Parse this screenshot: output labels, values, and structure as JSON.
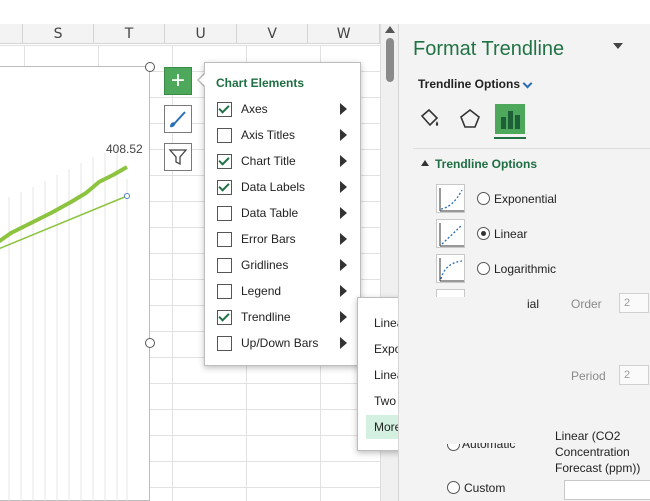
{
  "sheet": {
    "columns": [
      "S",
      "T",
      "U",
      "V",
      "W"
    ],
    "data_label": "408.52"
  },
  "chart_elements": {
    "title": "Chart Elements",
    "items": [
      {
        "label": "Axes",
        "checked": true
      },
      {
        "label": "Axis Titles",
        "checked": false
      },
      {
        "label": "Chart Title",
        "checked": true
      },
      {
        "label": "Data Labels",
        "checked": true
      },
      {
        "label": "Data Table",
        "checked": false
      },
      {
        "label": "Error Bars",
        "checked": false
      },
      {
        "label": "Gridlines",
        "checked": false
      },
      {
        "label": "Legend",
        "checked": false
      },
      {
        "label": "Trendline",
        "checked": true
      },
      {
        "label": "Up/Down Bars",
        "checked": false
      }
    ]
  },
  "trendline_submenu": {
    "items": [
      "Linear",
      "Exponential",
      "Linear Forecast",
      "Two Period Moving Average",
      "More Options..."
    ],
    "highlighted_index": 4
  },
  "pane": {
    "title": "Format Trendline",
    "options_dropdown": "Trendline Options",
    "section_title": "Trendline Options",
    "types": [
      {
        "label": "Exponential",
        "selected": false
      },
      {
        "label": "Linear",
        "selected": true
      },
      {
        "label": "Logarithmic",
        "selected": false
      }
    ],
    "partial_polynomial": "ial",
    "order_label": "Order",
    "order_value": "2",
    "period_label": "Period",
    "period_value": "2",
    "partial_automatic": "Automatic",
    "trend_name_lines": [
      "Linear (CO2",
      "Concentration",
      "Forecast (ppm))"
    ],
    "custom_label": "Custom"
  },
  "colors": {
    "accent": "#217346",
    "trend_line": "#8dc43f",
    "highlight": "#d3f0e0"
  }
}
